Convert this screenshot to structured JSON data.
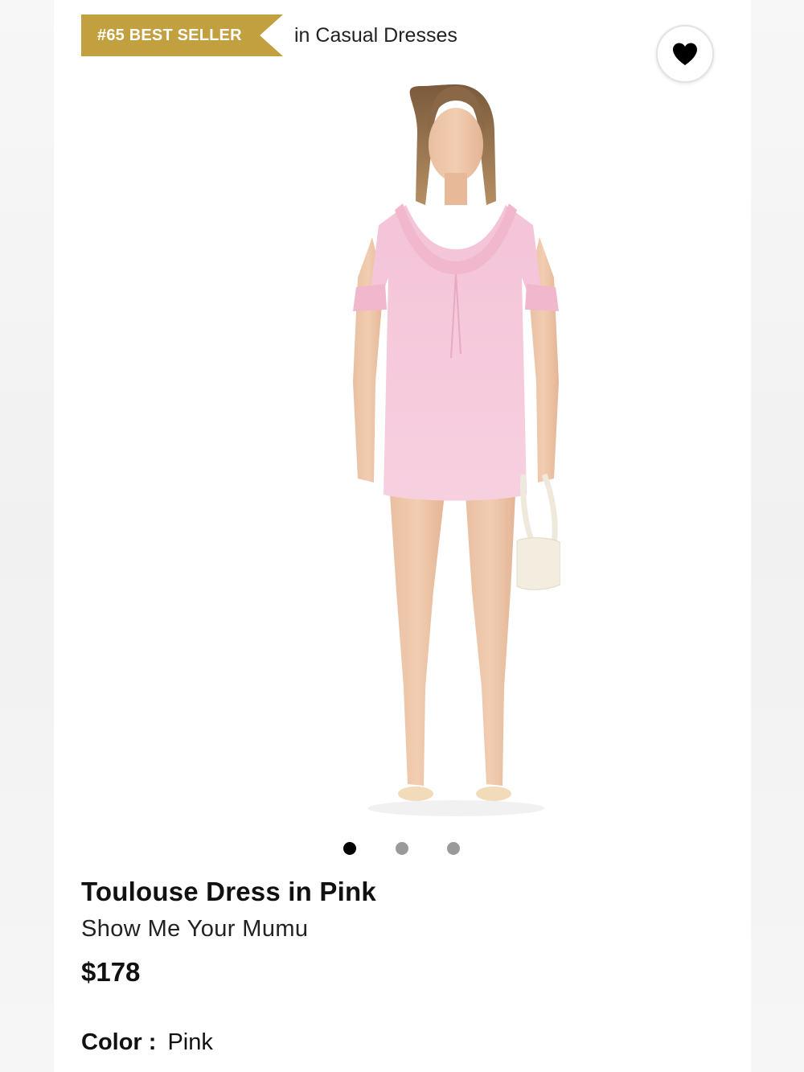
{
  "badge": {
    "rank_label": "#65 BEST SELLER",
    "category": "in Casual Dresses",
    "color": "#c2a03f"
  },
  "wishlist": {
    "icon": "heart-icon",
    "state": "filled"
  },
  "carousel": {
    "total": 3,
    "active_index": 0
  },
  "product": {
    "title": "Toulouse Dress in Pink",
    "brand": "Show Me Your Mumu",
    "price": "$178",
    "color_label": "Color :",
    "color_value": "Pink",
    "dress_color": "#f6c9dc"
  }
}
